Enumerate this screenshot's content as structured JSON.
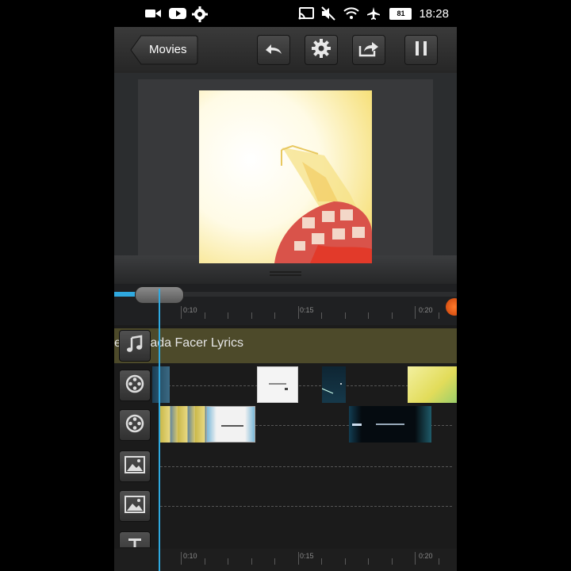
{
  "status_bar": {
    "time": "18:28",
    "battery": "81",
    "left_icons": [
      "video-camera-icon",
      "youtube-icon",
      "gear-icon"
    ],
    "right_icons": [
      "cast-icon",
      "mute-icon",
      "wifi-icon",
      "airplane-icon",
      "battery-icon"
    ]
  },
  "toolbar": {
    "back_label": "Movies",
    "buttons": [
      "undo-icon",
      "settings-icon",
      "share-icon",
      "pause-icon"
    ]
  },
  "scrubber": {
    "progress": 0.07,
    "ticks": [
      "0:10",
      "0:15",
      "0:20"
    ]
  },
  "timeline": {
    "music_title": "e  vis  Jada Facer Lyrics",
    "tracks": [
      "music",
      "video",
      "video",
      "image",
      "image",
      "text"
    ],
    "bottom_ticks": [
      "0:10",
      "0:15",
      "0:20"
    ]
  },
  "colors": {
    "accent": "#2fa9e0",
    "music_track": "#4d4a2a",
    "record_indicator": "#e8561a"
  }
}
